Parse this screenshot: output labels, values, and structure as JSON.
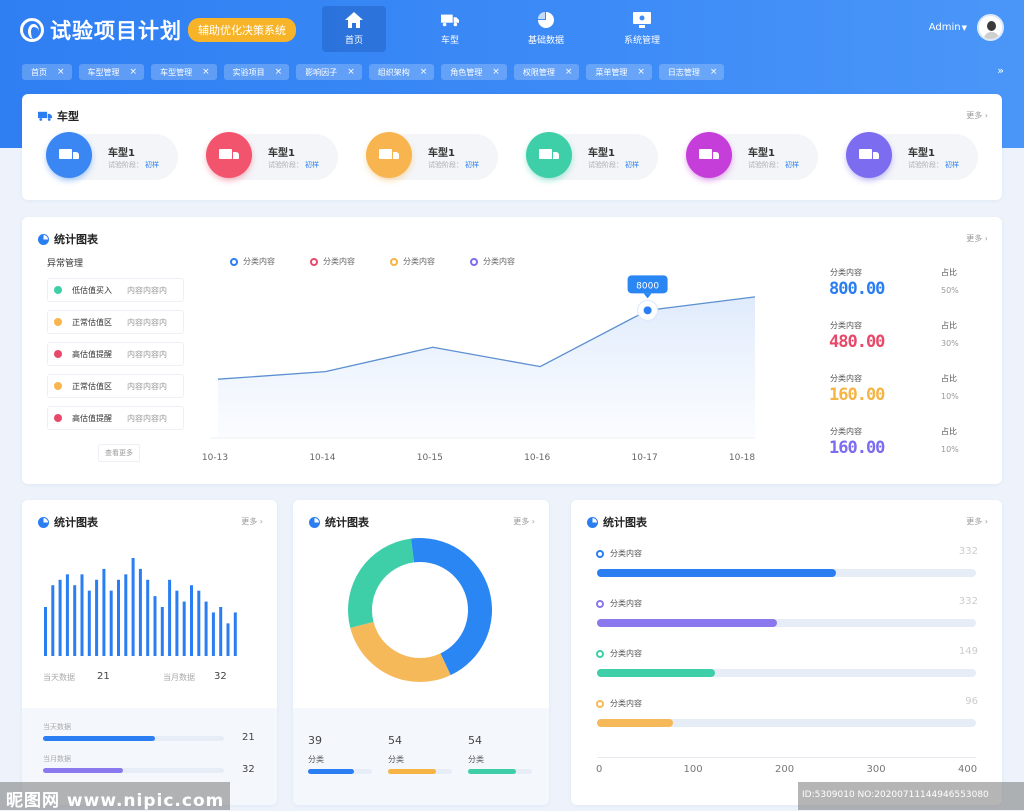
{
  "header": {
    "title": "试验项目计划",
    "badge": "辅助优化决策系统",
    "nav": [
      {
        "label": "首页",
        "icon": "home-icon",
        "active": true
      },
      {
        "label": "车型",
        "icon": "truck-icon",
        "active": false
      },
      {
        "label": "基础数据",
        "icon": "pie-chart-icon",
        "active": false
      },
      {
        "label": "系统管理",
        "icon": "monitor-icon",
        "active": false
      }
    ],
    "user": "Admin"
  },
  "tabs": [
    "首页",
    "车型管理",
    "车型管理",
    "实验项目",
    "影响因子",
    "组织架构",
    "角色管理",
    "权限管理",
    "菜单管理",
    "日志管理"
  ],
  "vehicle": {
    "title": "车型",
    "more": "更多",
    "items": [
      {
        "name": "车型1",
        "stage_label": "试验阶段：",
        "stage": "初样",
        "color": "#3a86f2"
      },
      {
        "name": "车型1",
        "stage_label": "试验阶段：",
        "stage": "初样",
        "color": "#f2546e"
      },
      {
        "name": "车型1",
        "stage_label": "试验阶段：",
        "stage": "初样",
        "color": "#f7b44f"
      },
      {
        "name": "车型1",
        "stage_label": "试验阶段：",
        "stage": "初样",
        "color": "#3ecfa9"
      },
      {
        "name": "车型1",
        "stage_label": "试验阶段：",
        "stage": "初样",
        "color": "#c63ed9"
      },
      {
        "name": "车型1",
        "stage_label": "试验阶段：",
        "stage": "初样",
        "color": "#7b6cf0"
      }
    ]
  },
  "stats": {
    "title": "统计图表",
    "more": "更多",
    "abnormal_title": "异常管理",
    "abnormal": [
      {
        "label": "低估值买入",
        "value": "内容内容内",
        "color": "#3ecfa9"
      },
      {
        "label": "正常估值区",
        "value": "内容内容内",
        "color": "#f7b44f"
      },
      {
        "label": "高估值提醒",
        "value": "内容内容内",
        "color": "#e8496a"
      },
      {
        "label": "正常估值区",
        "value": "内容内容内",
        "color": "#f7b44f"
      },
      {
        "label": "高估值提醒",
        "value": "内容内容内",
        "color": "#e8496a"
      }
    ],
    "view_more": "查看更多",
    "summary": [
      {
        "label": "分类内容",
        "value": "800.00",
        "pct_label": "占比",
        "pct": "50%",
        "color": "#2a7ef2"
      },
      {
        "label": "分类内容",
        "value": "480.00",
        "pct_label": "占比",
        "pct": "30%",
        "color": "#e8496a"
      },
      {
        "label": "分类内容",
        "value": "160.00",
        "pct_label": "占比",
        "pct": "10%",
        "color": "#f5b443"
      },
      {
        "label": "分类内容",
        "value": "160.00",
        "pct_label": "占比",
        "pct": "10%",
        "color": "#7b6cf0"
      }
    ]
  },
  "bar_card": {
    "title": "统计图表",
    "more": "更多",
    "today_label": "当天数据",
    "today_value": "21",
    "month_label": "当月数据",
    "month_value": "32",
    "prog": [
      {
        "label": "当天数据",
        "value": "21",
        "fraction": 0.62,
        "color": "#2a7ef2"
      },
      {
        "label": "当月数据",
        "value": "32",
        "fraction": 0.44,
        "color": "#8a78ee"
      }
    ]
  },
  "donut_card": {
    "title": "统计图表",
    "more": "更多",
    "items": [
      {
        "value": "39",
        "label": "分类",
        "color": "#2a7ef2",
        "fraction": 0.72
      },
      {
        "value": "54",
        "label": "分类",
        "color": "#f5b443",
        "fraction": 0.75
      },
      {
        "value": "54",
        "label": "分类",
        "color": "#3ecfa9",
        "fraction": 0.75
      }
    ]
  },
  "hbar_card": {
    "title": "统计图表",
    "more": "更多"
  },
  "watermark": {
    "left": "昵图网 www.nipic.com",
    "right": "ID:5309010 NO:20200711144946553080"
  },
  "chart_data": [
    {
      "type": "line",
      "legend": [
        "分类内容",
        "分类内容",
        "分类内容",
        "分类内容"
      ],
      "legend_colors": [
        "#2a7ef2",
        "#e8496a",
        "#f5b443",
        "#7b6cf0"
      ],
      "x": [
        "10-13",
        "10-14",
        "10-15",
        "10-16",
        "10-17",
        "10-18"
      ],
      "y_points": [
        {
          "x": "10-13",
          "y": 3500
        },
        {
          "x": "",
          "y": 3950
        },
        {
          "x": "",
          "y": 5400
        },
        {
          "x": "",
          "y": 4250
        },
        {
          "x": "",
          "y": 7600
        },
        {
          "x": "10-18",
          "y": 8400
        }
      ],
      "highlight": {
        "label": "8000",
        "index": 4
      },
      "ylim": [
        0,
        10000
      ],
      "grid": false
    },
    {
      "type": "bar",
      "values": [
        9,
        13,
        14,
        15,
        13,
        15,
        12,
        14,
        16,
        12,
        14,
        15,
        18,
        16,
        14,
        11,
        9,
        14,
        12,
        10,
        13,
        12,
        10,
        8,
        9,
        6,
        8
      ]
    },
    {
      "type": "pie",
      "slices": [
        {
          "value": 45,
          "color": "#2a86f3"
        },
        {
          "value": 28,
          "color": "#f5b95a"
        },
        {
          "value": 27,
          "color": "#3ecfa9"
        }
      ]
    },
    {
      "type": "bar",
      "orientation": "horizontal",
      "categories": [
        "分类内容",
        "分类内容",
        "分类内容",
        "分类内容"
      ],
      "values": [
        332,
        332,
        149,
        96
      ],
      "bar_values": [
        252,
        190,
        125,
        80
      ],
      "colors": [
        "#2a7ef2",
        "#8a78ee",
        "#3ecfa9",
        "#f5b95a"
      ],
      "x_ticks": [
        "0",
        "100",
        "200",
        "300",
        "400"
      ],
      "xlim": [
        0,
        400
      ]
    }
  ]
}
